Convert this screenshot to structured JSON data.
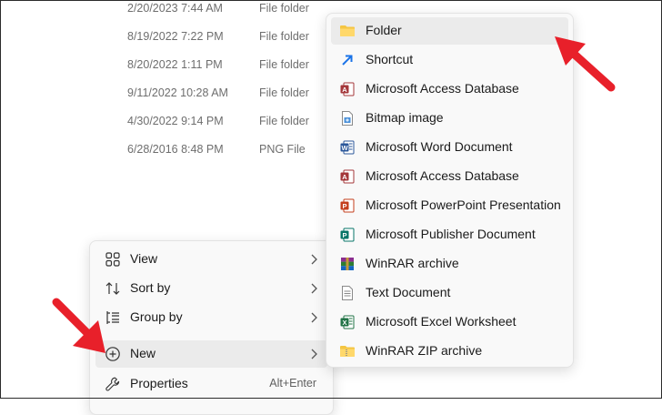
{
  "file_list": [
    {
      "date": "2/20/2023 7:44 AM",
      "type": "File folder"
    },
    {
      "date": "8/19/2022 7:22 PM",
      "type": "File folder"
    },
    {
      "date": "8/20/2022 1:11 PM",
      "type": "File folder"
    },
    {
      "date": "9/11/2022 10:28 AM",
      "type": "File folder"
    },
    {
      "date": "4/30/2022 9:14 PM",
      "type": "File folder"
    },
    {
      "date": "6/28/2016 8:48 PM",
      "type": "PNG File"
    }
  ],
  "context_menu": {
    "items": [
      {
        "label": "View",
        "icon": "view-grid-icon",
        "has_submenu": true
      },
      {
        "label": "Sort by",
        "icon": "sort-icon",
        "has_submenu": true
      },
      {
        "label": "Group by",
        "icon": "group-icon",
        "has_submenu": true
      },
      {
        "label": "New",
        "icon": "plus-circle-icon",
        "has_submenu": true,
        "active": true
      },
      {
        "label": "Properties",
        "icon": "wrench-icon",
        "shortcut": "Alt+Enter"
      }
    ]
  },
  "new_submenu": {
    "items": [
      {
        "label": "Folder",
        "icon": "folder-icon",
        "active": true
      },
      {
        "label": "Shortcut",
        "icon": "shortcut-icon"
      },
      {
        "label": "Microsoft Access Database",
        "icon": "access-icon"
      },
      {
        "label": "Bitmap image",
        "icon": "bitmap-icon"
      },
      {
        "label": "Microsoft Word Document",
        "icon": "word-icon"
      },
      {
        "label": "Microsoft Access Database",
        "icon": "access-icon"
      },
      {
        "label": "Microsoft PowerPoint Presentation",
        "icon": "powerpoint-icon"
      },
      {
        "label": "Microsoft Publisher Document",
        "icon": "publisher-icon"
      },
      {
        "label": "WinRAR archive",
        "icon": "winrar-icon"
      },
      {
        "label": "Text Document",
        "icon": "text-document-icon"
      },
      {
        "label": "Microsoft Excel Worksheet",
        "icon": "excel-icon"
      },
      {
        "label": "WinRAR ZIP archive",
        "icon": "winrar-zip-icon"
      }
    ]
  },
  "colors": {
    "annotation_arrow": "#e8202a",
    "hover_background": "#ebebeb",
    "menu_background": "#f9f9f9"
  }
}
